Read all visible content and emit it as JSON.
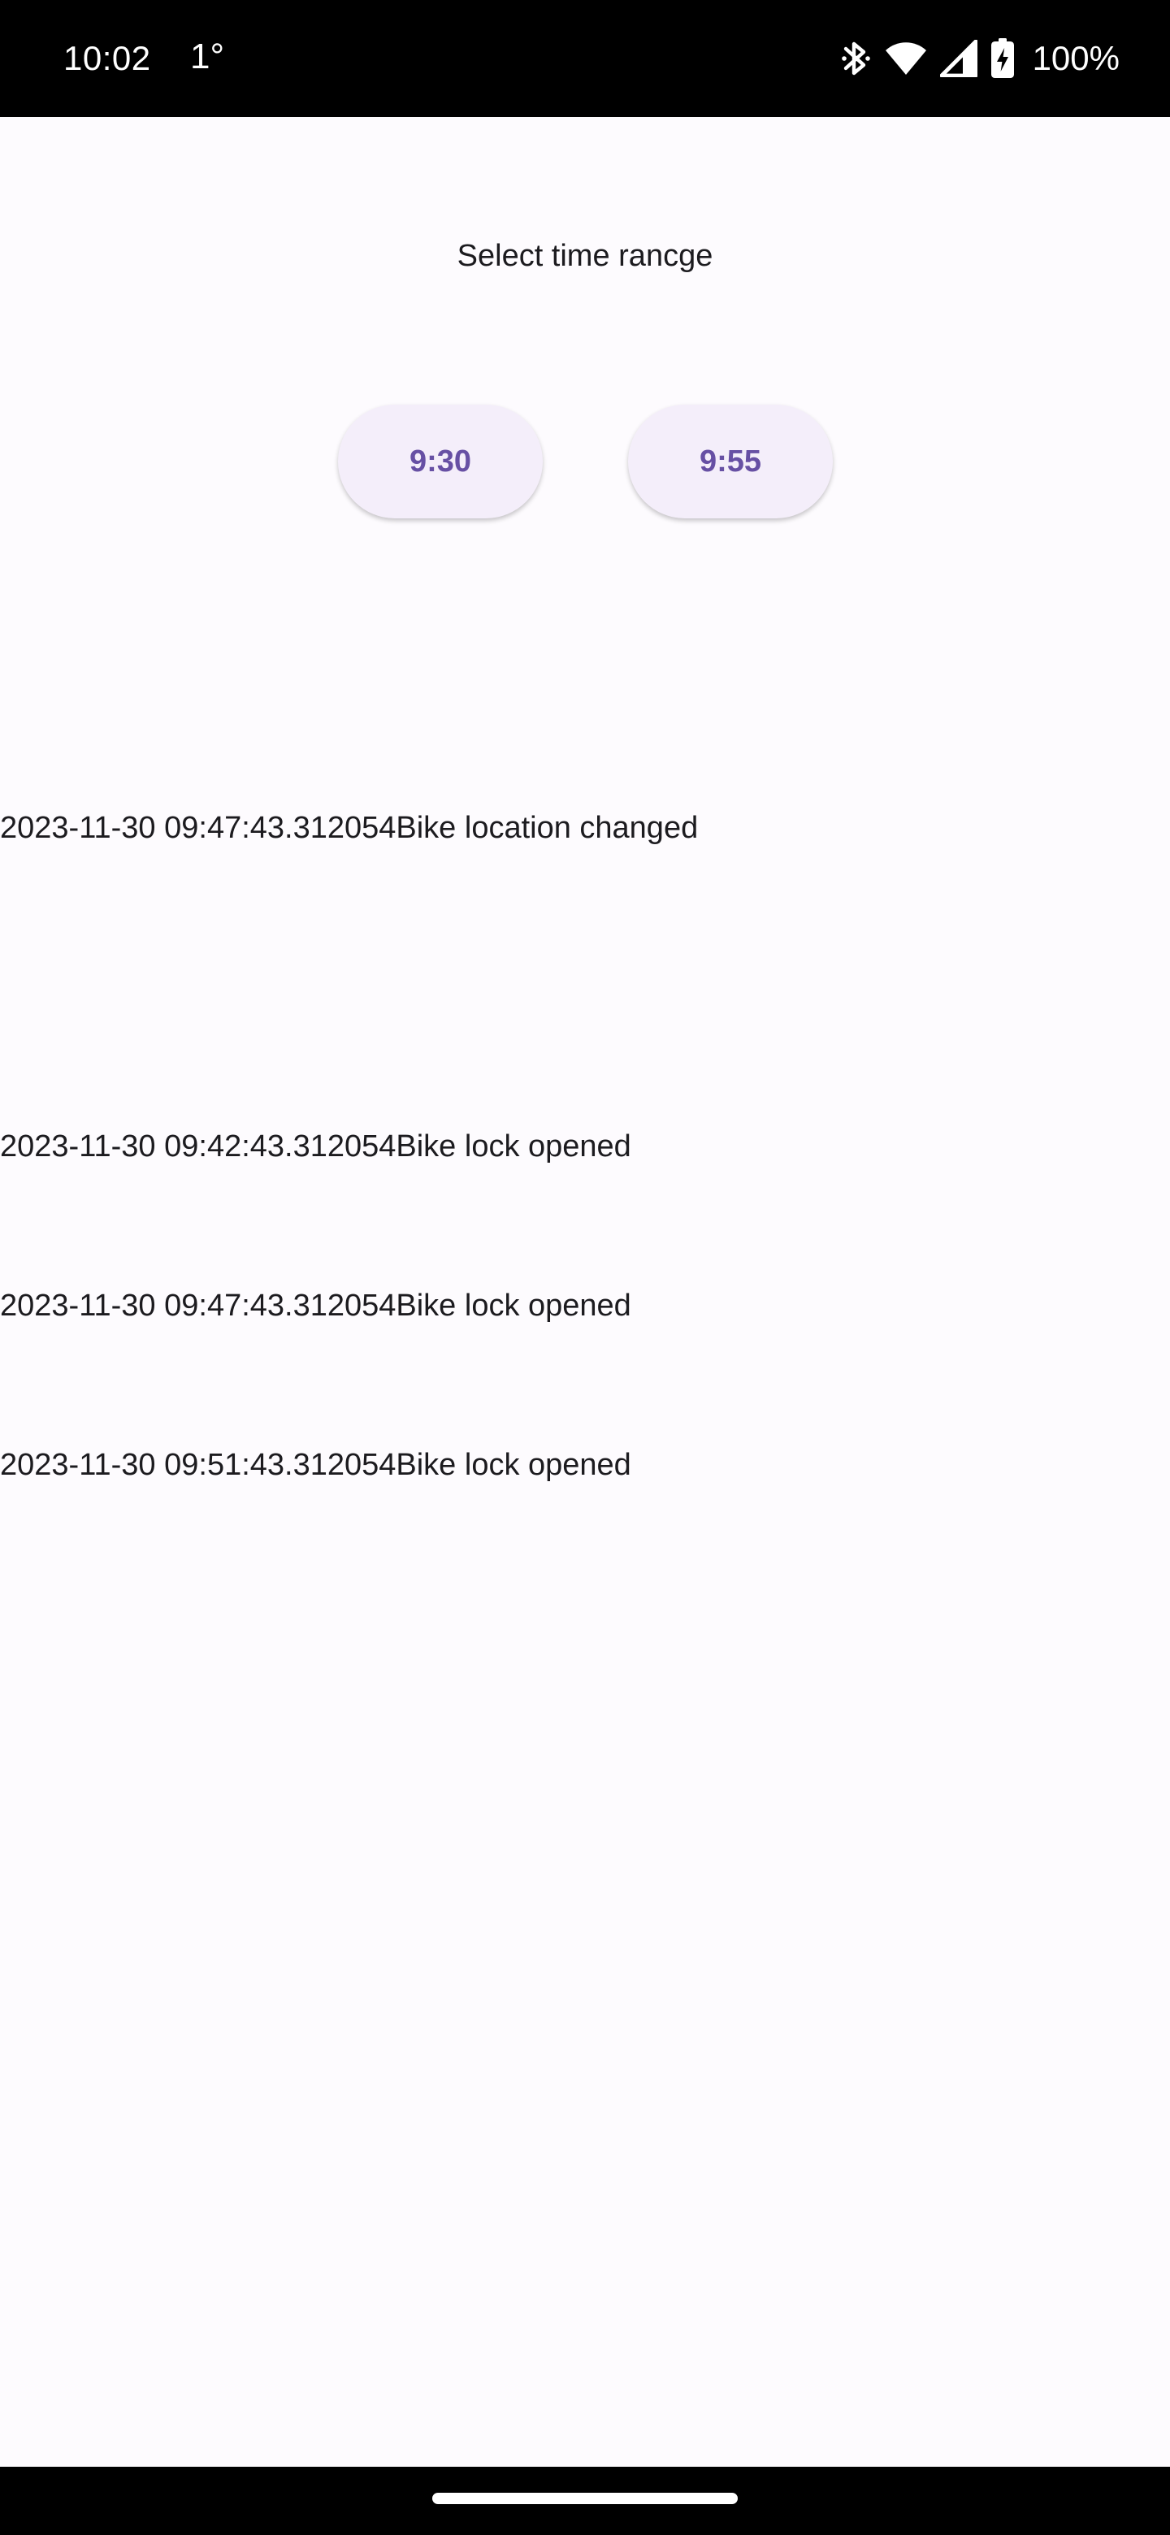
{
  "status_bar": {
    "time": "10:02",
    "temperature": "1°",
    "battery_percent": "100%",
    "icons": [
      "bluetooth-icon",
      "wifi-icon",
      "cellular-signal-icon",
      "battery-charging-icon"
    ]
  },
  "screen": {
    "title": "Select time rancge",
    "start_button_label": "9:30",
    "end_button_label": "9:55",
    "events": [
      "2023-11-30 09:47:43.312054Bike location changed",
      "2023-11-30 09:42:43.312054Bike lock opened",
      "2023-11-30 09:47:43.312054Bike lock opened",
      "2023-11-30 09:51:43.312054Bike lock opened"
    ]
  },
  "colors": {
    "background": "#fdfbfe",
    "button_background": "#f4eefa",
    "button_text": "#6750a4",
    "text": "#1c1b1f",
    "system_bars": "#000000"
  }
}
